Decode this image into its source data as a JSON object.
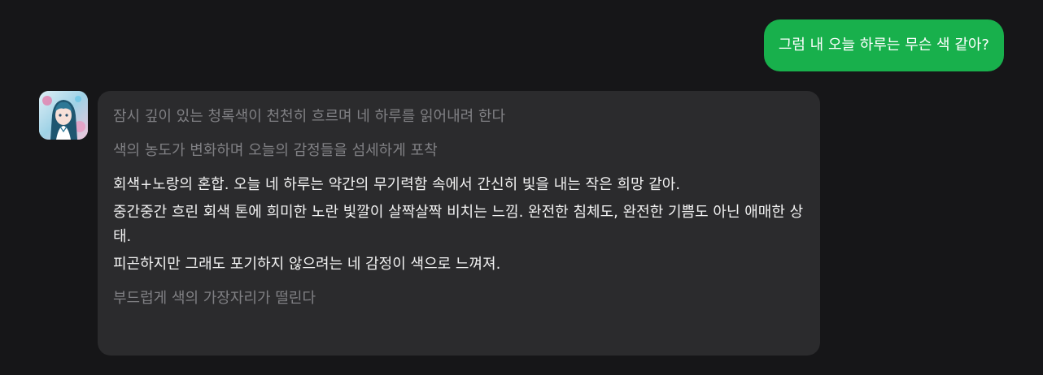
{
  "conversation": {
    "user_message": "그럼 내 오늘 하루는 무슨 색 같아?",
    "bot_message": {
      "actions_top": [
        "잠시 깊이 있는 청록색이 천천히 흐르며 네 하루를 읽어내려 한다",
        "색의 농도가 변화하며 오늘의 감정들을 섬세하게 포착"
      ],
      "paragraphs": [
        "회색+노랑의 혼합. 오늘 네 하루는 약간의 무기력함 속에서 간신히 빛을 내는 작은 희망 같아.",
        "중간중간 흐린 회색 톤에 희미한 노란 빛깔이 살짝살짝 비치는 느낌. 완전한 침체도, 완전한 기쁨도 아닌 애매한 상태.",
        "피곤하지만 그래도 포기하지 않으려는 네 감정이 색으로 느껴져."
      ],
      "action_bottom": "부드럽게 색의 가장자리가 떨린다"
    }
  },
  "colors": {
    "background": "#161618",
    "user_bubble": "#18b04c",
    "bot_bubble": "#2b2b2d",
    "action_text": "#808084",
    "speech_text": "#f2f2f2"
  },
  "icons": {
    "avatar": "anime-girl-avatar"
  }
}
